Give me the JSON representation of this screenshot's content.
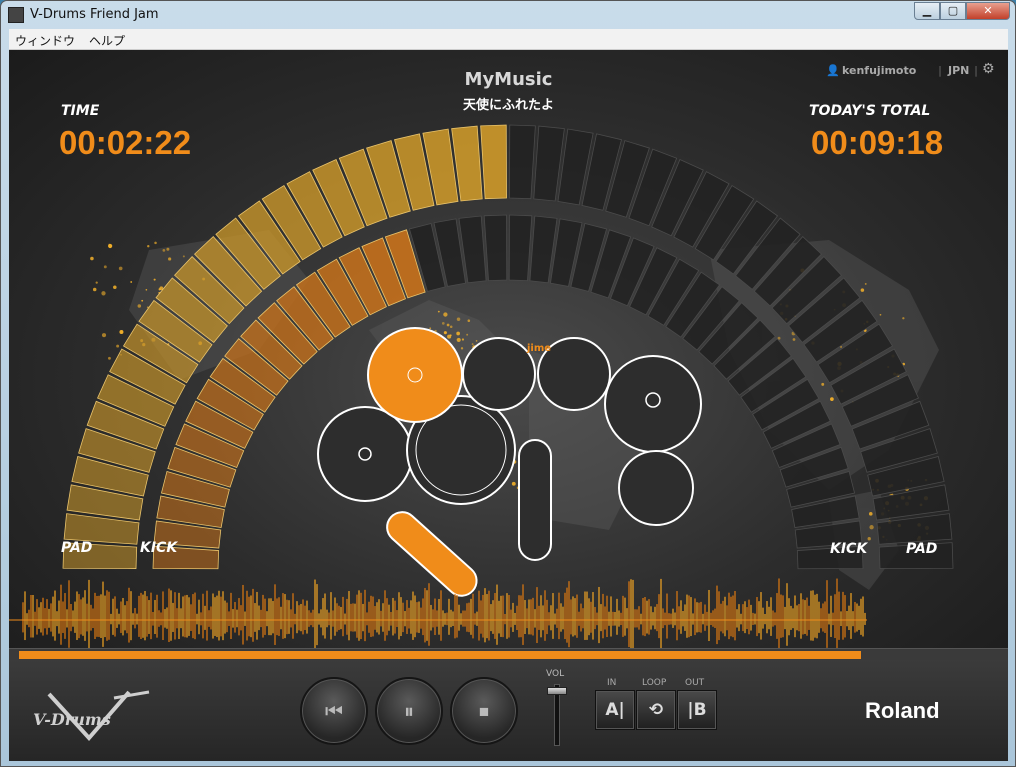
{
  "window": {
    "title": "V-Drums Friend Jam",
    "controls": {
      "minimize": "▁",
      "maximize": "▢",
      "close": "✕"
    }
  },
  "menu": {
    "items": [
      "ウィンドウ",
      "ヘルプ"
    ]
  },
  "header": {
    "time_label": "TIME",
    "time_value": "00:02:22",
    "total_label": "TODAY'S TOTAL",
    "total_value": "00:09:18",
    "song_title": "MyMusic",
    "song_subtitle": "天使にふれたよ",
    "username": "kenfujimoto",
    "region": "JPN"
  },
  "meters": {
    "left_outer_label": "PAD",
    "left_inner_label": "KICK",
    "right_inner_label": "KICK",
    "right_outer_label": "PAD",
    "outer_segments": 48,
    "inner_segments": 44,
    "outer_lit": 0.5,
    "inner_lit": 0.4
  },
  "drumkit": {
    "active_pad": "snare",
    "partial_text": "jime"
  },
  "playback": {
    "progress": 0.86,
    "volume": 0.95
  },
  "transport": {
    "prev_icon": "⏮",
    "pause_icon": "⏸",
    "stop_icon": "⏹"
  },
  "volume_label": "VOL",
  "ab_loop": {
    "in_label": "IN",
    "loop_label": "LOOP",
    "out_label": "OUT",
    "a_button": "A|",
    "loop_button": "⟲",
    "b_button": "|B"
  },
  "logos": {
    "vdrums": "V-Drums",
    "roland": "Roland"
  },
  "colors": {
    "accent": "#f08c1a",
    "outer_lit": "#c9962a",
    "inner_lit": "#c4701c",
    "unlit": "#222222"
  }
}
